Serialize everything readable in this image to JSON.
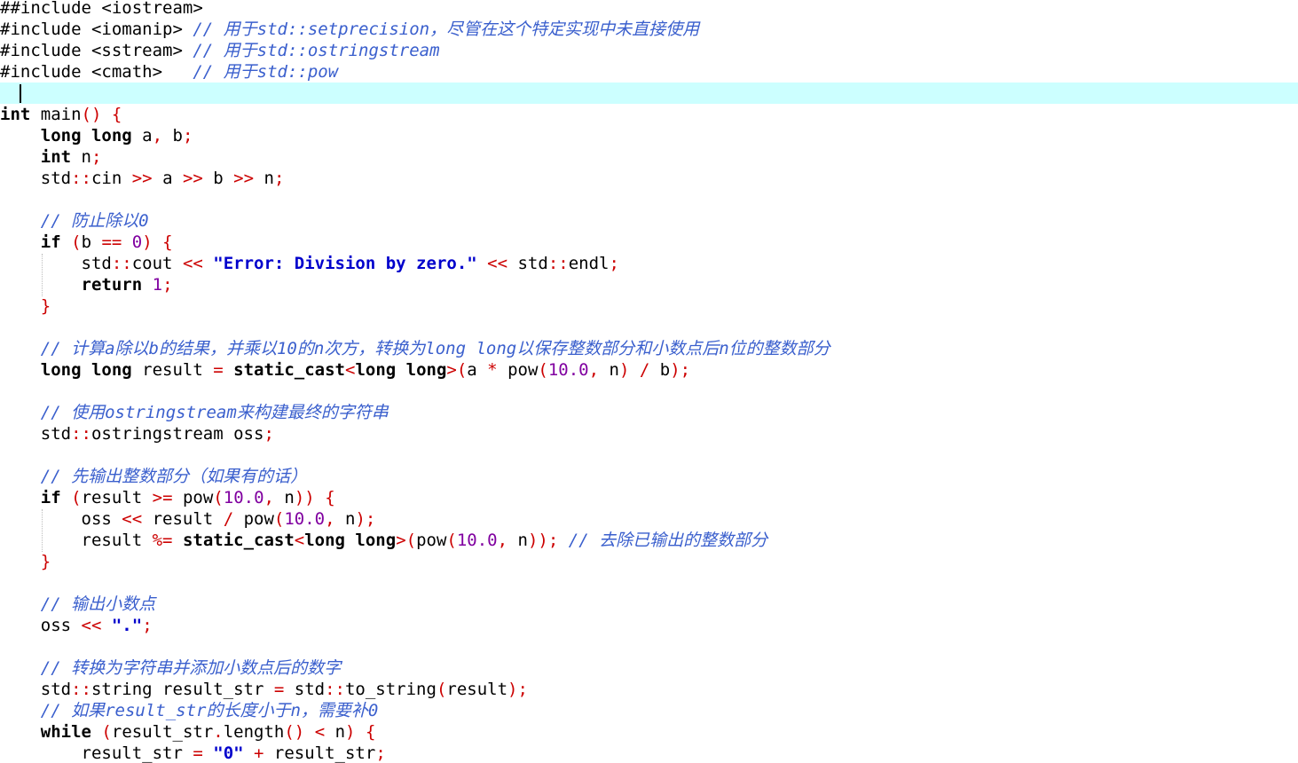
{
  "editor": {
    "title": "",
    "current_line_index": 4,
    "colors": {
      "keyword": "#000000",
      "operator": "#cc0000",
      "number": "#8000a0",
      "string": "#0000cc",
      "comment": "#3a5fcd",
      "current_line_bg": "#ccffff"
    },
    "lines": [
      [
        [
          "plain",
          "##include <iostream>"
        ]
      ],
      [
        [
          "plain",
          "#include <iomanip> "
        ],
        [
          "com",
          "// 用于std::setprecision，尽管在这个特定实现中未直接使用"
        ]
      ],
      [
        [
          "plain",
          "#include <sstream> "
        ],
        [
          "com",
          "// 用于std::ostringstream"
        ]
      ],
      [
        [
          "plain",
          "#include <cmath>   "
        ],
        [
          "com",
          "// 用于std::pow"
        ]
      ],
      [
        [
          "plain",
          "  "
        ]
      ],
      [
        [
          "kw",
          "int"
        ],
        [
          "plain",
          " main"
        ],
        [
          "op",
          "()"
        ],
        [
          "plain",
          " "
        ],
        [
          "op",
          "{"
        ]
      ],
      [
        [
          "plain",
          "    "
        ],
        [
          "kw",
          "long long"
        ],
        [
          "plain",
          " a"
        ],
        [
          "op",
          ","
        ],
        [
          "plain",
          " b"
        ],
        [
          "op",
          ";"
        ]
      ],
      [
        [
          "plain",
          "    "
        ],
        [
          "kw",
          "int"
        ],
        [
          "plain",
          " n"
        ],
        [
          "op",
          ";"
        ]
      ],
      [
        [
          "plain",
          "    std"
        ],
        [
          "op",
          "::"
        ],
        [
          "plain",
          "cin "
        ],
        [
          "op",
          ">>"
        ],
        [
          "plain",
          " a "
        ],
        [
          "op",
          ">>"
        ],
        [
          "plain",
          " b "
        ],
        [
          "op",
          ">>"
        ],
        [
          "plain",
          " n"
        ],
        [
          "op",
          ";"
        ]
      ],
      [
        [
          "plain",
          ""
        ]
      ],
      [
        [
          "plain",
          "    "
        ],
        [
          "com",
          "// 防止除以0"
        ]
      ],
      [
        [
          "plain",
          "    "
        ],
        [
          "kw",
          "if"
        ],
        [
          "plain",
          " "
        ],
        [
          "op",
          "("
        ],
        [
          "plain",
          "b "
        ],
        [
          "op",
          "=="
        ],
        [
          "plain",
          " "
        ],
        [
          "num",
          "0"
        ],
        [
          "op",
          ")"
        ],
        [
          "plain",
          " "
        ],
        [
          "op",
          "{"
        ]
      ],
      [
        [
          "plain",
          "        std"
        ],
        [
          "op",
          "::"
        ],
        [
          "plain",
          "cout "
        ],
        [
          "op",
          "<<"
        ],
        [
          "plain",
          " "
        ],
        [
          "str",
          "\"Error: Division by zero.\""
        ],
        [
          "plain",
          " "
        ],
        [
          "op",
          "<<"
        ],
        [
          "plain",
          " std"
        ],
        [
          "op",
          "::"
        ],
        [
          "plain",
          "endl"
        ],
        [
          "op",
          ";"
        ]
      ],
      [
        [
          "plain",
          "        "
        ],
        [
          "kw",
          "return"
        ],
        [
          "plain",
          " "
        ],
        [
          "num",
          "1"
        ],
        [
          "op",
          ";"
        ]
      ],
      [
        [
          "plain",
          "    "
        ],
        [
          "op",
          "}"
        ]
      ],
      [
        [
          "plain",
          ""
        ]
      ],
      [
        [
          "plain",
          "    "
        ],
        [
          "com",
          "// 计算a除以b的结果，并乘以10的n次方，转换为long long以保存整数部分和小数点后n位的整数部分"
        ]
      ],
      [
        [
          "plain",
          "    "
        ],
        [
          "kw",
          "long long"
        ],
        [
          "plain",
          " result "
        ],
        [
          "op",
          "="
        ],
        [
          "plain",
          " "
        ],
        [
          "kw",
          "static_cast"
        ],
        [
          "op",
          "<"
        ],
        [
          "kw",
          "long long"
        ],
        [
          "op",
          ">("
        ],
        [
          "plain",
          "a "
        ],
        [
          "op",
          "*"
        ],
        [
          "plain",
          " pow"
        ],
        [
          "op",
          "("
        ],
        [
          "num",
          "10.0"
        ],
        [
          "op",
          ","
        ],
        [
          "plain",
          " n"
        ],
        [
          "op",
          ")"
        ],
        [
          "plain",
          " "
        ],
        [
          "op",
          "/"
        ],
        [
          "plain",
          " b"
        ],
        [
          "op",
          ");"
        ]
      ],
      [
        [
          "plain",
          ""
        ]
      ],
      [
        [
          "plain",
          "    "
        ],
        [
          "com",
          "// 使用ostringstream来构建最终的字符串"
        ]
      ],
      [
        [
          "plain",
          "    std"
        ],
        [
          "op",
          "::"
        ],
        [
          "plain",
          "ostringstream oss"
        ],
        [
          "op",
          ";"
        ]
      ],
      [
        [
          "plain",
          ""
        ]
      ],
      [
        [
          "plain",
          "    "
        ],
        [
          "com",
          "// 先输出整数部分（如果有的话）"
        ]
      ],
      [
        [
          "plain",
          "    "
        ],
        [
          "kw",
          "if"
        ],
        [
          "plain",
          " "
        ],
        [
          "op",
          "("
        ],
        [
          "plain",
          "result "
        ],
        [
          "op",
          ">="
        ],
        [
          "plain",
          " pow"
        ],
        [
          "op",
          "("
        ],
        [
          "num",
          "10.0"
        ],
        [
          "op",
          ","
        ],
        [
          "plain",
          " n"
        ],
        [
          "op",
          "))"
        ],
        [
          "plain",
          " "
        ],
        [
          "op",
          "{"
        ]
      ],
      [
        [
          "plain",
          "        oss "
        ],
        [
          "op",
          "<<"
        ],
        [
          "plain",
          " result "
        ],
        [
          "op",
          "/"
        ],
        [
          "plain",
          " pow"
        ],
        [
          "op",
          "("
        ],
        [
          "num",
          "10.0"
        ],
        [
          "op",
          ","
        ],
        [
          "plain",
          " n"
        ],
        [
          "op",
          ");"
        ]
      ],
      [
        [
          "plain",
          "        result "
        ],
        [
          "op",
          "%="
        ],
        [
          "plain",
          " "
        ],
        [
          "kw",
          "static_cast"
        ],
        [
          "op",
          "<"
        ],
        [
          "kw",
          "long long"
        ],
        [
          "op",
          ">("
        ],
        [
          "plain",
          "pow"
        ],
        [
          "op",
          "("
        ],
        [
          "num",
          "10.0"
        ],
        [
          "op",
          ","
        ],
        [
          "plain",
          " n"
        ],
        [
          "op",
          "));"
        ],
        [
          "plain",
          " "
        ],
        [
          "com",
          "// 去除已输出的整数部分"
        ]
      ],
      [
        [
          "plain",
          "    "
        ],
        [
          "op",
          "}"
        ]
      ],
      [
        [
          "plain",
          ""
        ]
      ],
      [
        [
          "plain",
          "    "
        ],
        [
          "com",
          "// 输出小数点"
        ]
      ],
      [
        [
          "plain",
          "    oss "
        ],
        [
          "op",
          "<<"
        ],
        [
          "plain",
          " "
        ],
        [
          "str",
          "\".\""
        ],
        [
          "op",
          ";"
        ]
      ],
      [
        [
          "plain",
          ""
        ]
      ],
      [
        [
          "plain",
          "    "
        ],
        [
          "com",
          "// 转换为字符串并添加小数点后的数字"
        ]
      ],
      [
        [
          "plain",
          "    std"
        ],
        [
          "op",
          "::"
        ],
        [
          "plain",
          "string result_str "
        ],
        [
          "op",
          "="
        ],
        [
          "plain",
          " std"
        ],
        [
          "op",
          "::"
        ],
        [
          "plain",
          "to_string"
        ],
        [
          "op",
          "("
        ],
        [
          "plain",
          "result"
        ],
        [
          "op",
          ");"
        ]
      ],
      [
        [
          "plain",
          "    "
        ],
        [
          "com",
          "// 如果result_str的长度小于n，需要补0"
        ]
      ],
      [
        [
          "plain",
          "    "
        ],
        [
          "kw",
          "while"
        ],
        [
          "plain",
          " "
        ],
        [
          "op",
          "("
        ],
        [
          "plain",
          "result_str"
        ],
        [
          "op",
          "."
        ],
        [
          "plain",
          "length"
        ],
        [
          "op",
          "()"
        ],
        [
          "plain",
          " "
        ],
        [
          "op",
          "<"
        ],
        [
          "plain",
          " n"
        ],
        [
          "op",
          ")"
        ],
        [
          "plain",
          " "
        ],
        [
          "op",
          "{"
        ]
      ],
      [
        [
          "plain",
          "        result_str "
        ],
        [
          "op",
          "="
        ],
        [
          "plain",
          " "
        ],
        [
          "str",
          "\"0\""
        ],
        [
          "plain",
          " "
        ],
        [
          "op",
          "+"
        ],
        [
          "plain",
          " result_str"
        ],
        [
          "op",
          ";"
        ]
      ]
    ]
  }
}
